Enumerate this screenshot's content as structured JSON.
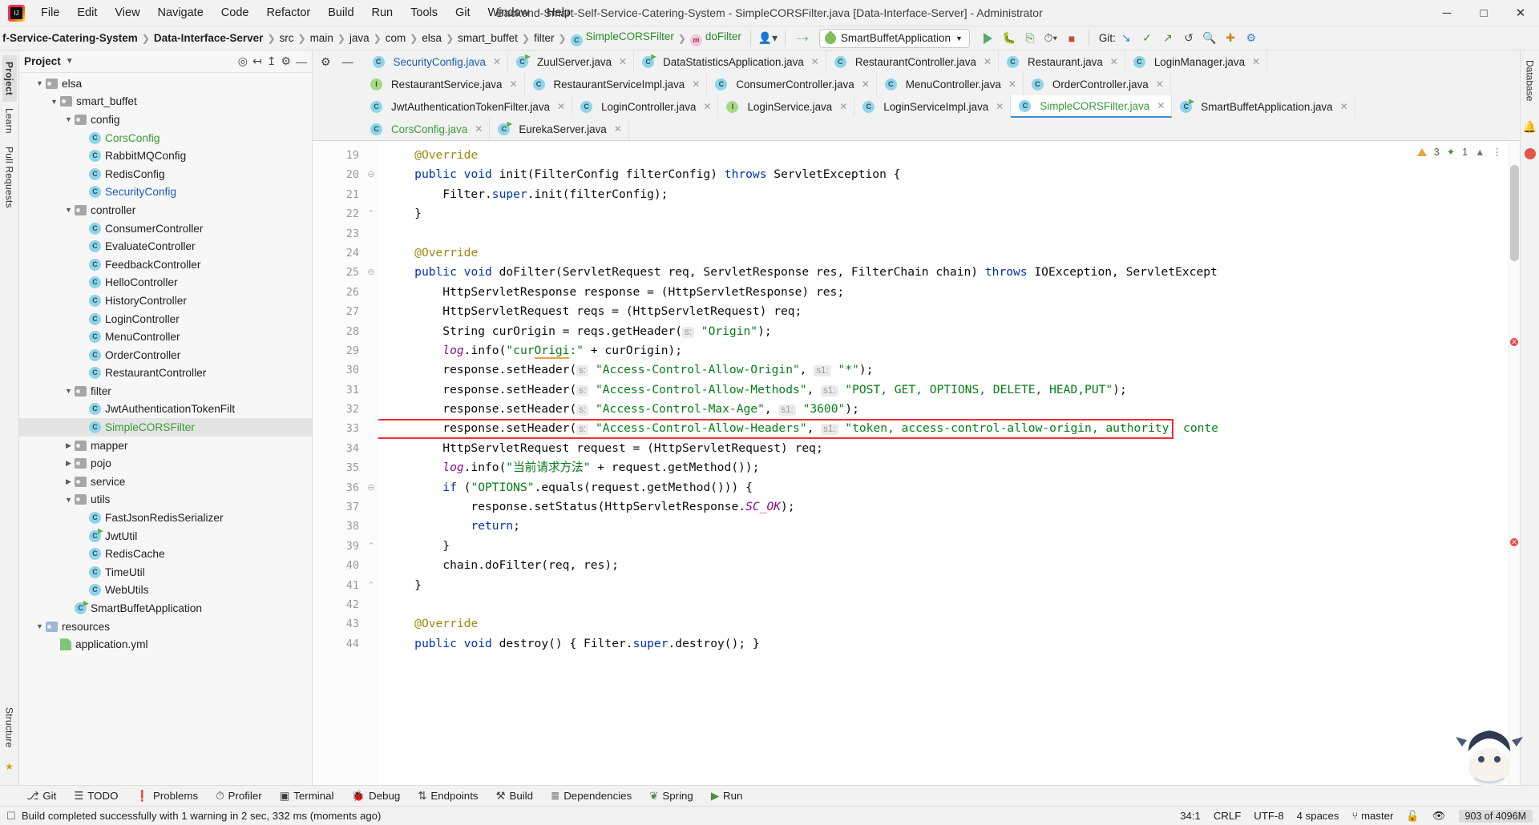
{
  "window": {
    "title": "Backend-Smart-Self-Service-Catering-System - SimpleCORSFilter.java [Data-Interface-Server] - Administrator",
    "minimize": "─",
    "maximize": "□",
    "close": "✕",
    "logo_text": "IJ"
  },
  "menu": [
    "File",
    "Edit",
    "View",
    "Navigate",
    "Code",
    "Refactor",
    "Build",
    "Run",
    "Tools",
    "Git",
    "Window",
    "Help"
  ],
  "breadcrumbs": [
    {
      "label": "f-Service-Catering-System",
      "style": "bold"
    },
    {
      "label": "Data-Interface-Server",
      "style": "bold"
    },
    {
      "label": "src",
      "style": "plain"
    },
    {
      "label": "main",
      "style": "plain"
    },
    {
      "label": "java",
      "style": "plain"
    },
    {
      "label": "com",
      "style": "plain"
    },
    {
      "label": "elsa",
      "style": "plain"
    },
    {
      "label": "smart_buffet",
      "style": "plain"
    },
    {
      "label": "filter",
      "style": "plain"
    },
    {
      "label": "SimpleCORSFilter",
      "style": "class-green"
    },
    {
      "label": "doFilter",
      "style": "method-green"
    }
  ],
  "toolbar": {
    "run_config": "SmartBuffetApplication",
    "git_label": "Git:",
    "icons": [
      "profile-icon",
      "hammer-icon",
      "run-icon",
      "debug-icon",
      "coverage-icon",
      "profiler-icon",
      "stop-icon",
      "git-update-icon",
      "git-commit-icon",
      "git-push-icon",
      "undo-icon",
      "search-icon",
      "plus-icon",
      "settings-icon"
    ]
  },
  "project_panel": {
    "title": "Project",
    "head_icons": [
      "target-icon",
      "collapse-icon",
      "expand-icon",
      "gear-icon",
      "hide-icon"
    ],
    "tree": [
      {
        "indent": 4,
        "kind": "folder",
        "label": "elsa",
        "arrow": "down",
        "color": "default"
      },
      {
        "indent": 5,
        "kind": "folder",
        "label": "smart_buffet",
        "arrow": "down",
        "color": "default"
      },
      {
        "indent": 6,
        "kind": "folder",
        "label": "config",
        "arrow": "down",
        "color": "default"
      },
      {
        "indent": 7,
        "kind": "class",
        "label": "CorsConfig",
        "arrow": "none",
        "color": "green"
      },
      {
        "indent": 7,
        "kind": "class",
        "label": "RabbitMQConfig",
        "arrow": "none",
        "color": "default"
      },
      {
        "indent": 7,
        "kind": "class",
        "label": "RedisConfig",
        "arrow": "none",
        "color": "default"
      },
      {
        "indent": 7,
        "kind": "class",
        "label": "SecurityConfig",
        "arrow": "none",
        "color": "blue"
      },
      {
        "indent": 6,
        "kind": "folder",
        "label": "controller",
        "arrow": "down",
        "color": "default"
      },
      {
        "indent": 7,
        "kind": "class",
        "label": "ConsumerController",
        "arrow": "none",
        "color": "default"
      },
      {
        "indent": 7,
        "kind": "class",
        "label": "EvaluateController",
        "arrow": "none",
        "color": "default"
      },
      {
        "indent": 7,
        "kind": "class",
        "label": "FeedbackController",
        "arrow": "none",
        "color": "default"
      },
      {
        "indent": 7,
        "kind": "class",
        "label": "HelloController",
        "arrow": "none",
        "color": "default"
      },
      {
        "indent": 7,
        "kind": "class",
        "label": "HistoryController",
        "arrow": "none",
        "color": "default"
      },
      {
        "indent": 7,
        "kind": "class",
        "label": "LoginController",
        "arrow": "none",
        "color": "default"
      },
      {
        "indent": 7,
        "kind": "class",
        "label": "MenuController",
        "arrow": "none",
        "color": "default"
      },
      {
        "indent": 7,
        "kind": "class",
        "label": "OrderController",
        "arrow": "none",
        "color": "default"
      },
      {
        "indent": 7,
        "kind": "class",
        "label": "RestaurantController",
        "arrow": "none",
        "color": "default"
      },
      {
        "indent": 6,
        "kind": "folder",
        "label": "filter",
        "arrow": "down",
        "color": "default"
      },
      {
        "indent": 7,
        "kind": "class",
        "label": "JwtAuthenticationTokenFilt",
        "arrow": "none",
        "color": "default"
      },
      {
        "indent": 7,
        "kind": "class",
        "label": "SimpleCORSFilter",
        "arrow": "none",
        "color": "green",
        "selected": true
      },
      {
        "indent": 6,
        "kind": "folder",
        "label": "mapper",
        "arrow": "right",
        "color": "default"
      },
      {
        "indent": 6,
        "kind": "folder",
        "label": "pojo",
        "arrow": "right",
        "color": "default"
      },
      {
        "indent": 6,
        "kind": "folder",
        "label": "service",
        "arrow": "right",
        "color": "default"
      },
      {
        "indent": 6,
        "kind": "folder",
        "label": "utils",
        "arrow": "down",
        "color": "default"
      },
      {
        "indent": 7,
        "kind": "class",
        "label": "FastJsonRedisSerializer",
        "arrow": "none",
        "color": "default"
      },
      {
        "indent": 7,
        "kind": "class-spring",
        "label": "JwtUtil",
        "arrow": "none",
        "color": "default"
      },
      {
        "indent": 7,
        "kind": "class",
        "label": "RedisCache",
        "arrow": "none",
        "color": "default"
      },
      {
        "indent": 7,
        "kind": "class",
        "label": "TimeUtil",
        "arrow": "none",
        "color": "default"
      },
      {
        "indent": 7,
        "kind": "class",
        "label": "WebUtils",
        "arrow": "none",
        "color": "default"
      },
      {
        "indent": 6,
        "kind": "class-spring",
        "label": "SmartBuffetApplication",
        "arrow": "none",
        "color": "default"
      },
      {
        "indent": 4,
        "kind": "folder-res",
        "label": "resources",
        "arrow": "down",
        "color": "default"
      },
      {
        "indent": 5,
        "kind": "xml",
        "label": "application.yml",
        "arrow": "none",
        "color": "default"
      }
    ]
  },
  "left_rail": [
    "Project",
    "Learn",
    "Pull Requests",
    "Structure",
    "Favorites"
  ],
  "right_rail": [
    "Database",
    "Notifications"
  ],
  "editor_tabs": [
    [
      {
        "label": "SecurityConfig.java",
        "icon": "class-icon",
        "color": "blue"
      },
      {
        "label": "ZuulServer.java",
        "icon": "spring-class-icon",
        "color": "default"
      },
      {
        "label": "DataStatisticsApplication.java",
        "icon": "spring-class-icon",
        "color": "default"
      },
      {
        "label": "RestaurantController.java",
        "icon": "class-icon",
        "color": "default"
      },
      {
        "label": "Restaurant.java",
        "icon": "class-icon",
        "color": "default"
      },
      {
        "label": "LoginManager.java",
        "icon": "class-icon",
        "color": "default"
      }
    ],
    [
      {
        "label": "RestaurantService.java",
        "icon": "interface-icon",
        "color": "default"
      },
      {
        "label": "RestaurantServiceImpl.java",
        "icon": "class-icon",
        "color": "default"
      },
      {
        "label": "ConsumerController.java",
        "icon": "class-icon",
        "color": "default"
      },
      {
        "label": "MenuController.java",
        "icon": "class-icon",
        "color": "default"
      },
      {
        "label": "OrderController.java",
        "icon": "class-icon",
        "color": "default"
      }
    ],
    [
      {
        "label": "JwtAuthenticationTokenFilter.java",
        "icon": "class-icon",
        "color": "default"
      },
      {
        "label": "LoginController.java",
        "icon": "class-icon",
        "color": "default"
      },
      {
        "label": "LoginService.java",
        "icon": "interface-icon",
        "color": "default"
      },
      {
        "label": "LoginServiceImpl.java",
        "icon": "class-icon",
        "color": "default"
      },
      {
        "label": "SimpleCORSFilter.java",
        "icon": "class-icon",
        "color": "green",
        "active": true
      },
      {
        "label": "SmartBuffetApplication.java",
        "icon": "spring-class-icon",
        "color": "default"
      }
    ],
    [
      {
        "label": "CorsConfig.java",
        "icon": "class-icon",
        "color": "green"
      },
      {
        "label": "EurekaServer.java",
        "icon": "spring-class-icon",
        "color": "default"
      }
    ]
  ],
  "inspection": {
    "warnings": "3",
    "weak_warnings": "1",
    "warn_icon": "warning-triangle-icon",
    "weak_icon": "weak-warning-icon"
  },
  "code": {
    "first_line_number": 19,
    "highlight_line_number": 33,
    "lines": [
      {
        "n": 19,
        "html": "    <span class='ann'>@Override</span>"
      },
      {
        "n": 20,
        "html": "    <span class='kw'>public</span> <span class='kw'>void</span> init(FilterConfig filterConfig) <span class='kw'>throws</span> ServletException {",
        "gutter_mark": "override-impl",
        "fold": "open"
      },
      {
        "n": 21,
        "html": "        Filter.<span class='kw'>super</span>.init(filterConfig);"
      },
      {
        "n": 22,
        "html": "    }",
        "fold": "close"
      },
      {
        "n": 23,
        "html": ""
      },
      {
        "n": 24,
        "html": "    <span class='ann'>@Override</span>"
      },
      {
        "n": 25,
        "html": "    <span class='kw'>public</span> <span class='kw'>void</span> doFilter(ServletRequest req, ServletResponse res, FilterChain chain) <span class='kw'>throws</span> IOException, ServletExcept",
        "gutter_mark": "override",
        "fold": "open"
      },
      {
        "n": 26,
        "html": "        HttpServletResponse response = (HttpServletResponse) res;"
      },
      {
        "n": 27,
        "html": "        HttpServletRequest reqs = (HttpServletRequest) req;"
      },
      {
        "n": 28,
        "html": "        String curOrigin = reqs.getHeader(<span class='hint'>s:</span> <span class='str'>\"Origin\"</span>);"
      },
      {
        "n": 29,
        "html": "        <span class='fld'>log</span>.info(<span class='str'>\"cur<span class='typo'>Origi</span>:\"</span> + curOrigin);"
      },
      {
        "n": 30,
        "html": "        response.setHeader(<span class='hint'>s:</span> <span class='str'>\"Access-Control-Allow-Origin\"</span>, <span class='hint'>s1:</span> <span class='str'>\"*\"</span>);"
      },
      {
        "n": 31,
        "html": "        response.setHeader(<span class='hint'>s:</span> <span class='str'>\"Access-Control-Allow-Methods\"</span>, <span class='hint'>s1:</span> <span class='str'>\"POST, GET, OPTIONS, DELETE, HEAD,PUT\"</span>);"
      },
      {
        "n": 32,
        "html": "        response.setHeader(<span class='hint'>s:</span> <span class='str'>\"Access-Control-Max-Age\"</span>, <span class='hint'>s1:</span> <span class='str'>\"3600\"</span>);"
      },
      {
        "n": 33,
        "html": "        response.setHeader(<span class='hint'>s:</span> <span class='str'>\"Access-Control-Allow-Headers\"</span>, <span class='hint'>s1:</span> <span class='str'>\"token, access-control-allow-origin, authority, conte</span>"
      },
      {
        "n": 34,
        "html": "        HttpServletRequest request = (HttpServletRequest) req;"
      },
      {
        "n": 35,
        "html": "        <span class='fld'>log</span>.info(<span class='str'>\"当前请求方法\"</span> + request.getMethod());"
      },
      {
        "n": 36,
        "html": "        <span class='kw'>if</span> (<span class='str'>\"OPTIONS\"</span>.equals(request.getMethod())) {",
        "fold": "open"
      },
      {
        "n": 37,
        "html": "            response.setStatus(HttpServletResponse.<span class='cst'>SC_OK</span>);"
      },
      {
        "n": 38,
        "html": "            <span class='kw'>return</span>;"
      },
      {
        "n": 39,
        "html": "        }",
        "fold": "close"
      },
      {
        "n": 40,
        "html": "        chain.doFilter(req, res);"
      },
      {
        "n": 41,
        "html": "    }",
        "fold": "close"
      },
      {
        "n": 42,
        "html": ""
      },
      {
        "n": 43,
        "html": "    <span class='ann'>@Override</span>"
      },
      {
        "n": 44,
        "html": "    <span class='kw'>public</span> <span class='kw'>void</span> destroy() { Filter.<span class='kw'>super</span>.destroy(); }",
        "gutter_mark": "override"
      }
    ]
  },
  "bottom_toolwindows": [
    {
      "label": "Git",
      "icon": "git-branch-icon"
    },
    {
      "label": "TODO",
      "icon": "list-icon"
    },
    {
      "label": "Problems",
      "icon": "exclamation-circle-icon"
    },
    {
      "label": "Profiler",
      "icon": "profiler-icon"
    },
    {
      "label": "Terminal",
      "icon": "terminal-icon"
    },
    {
      "label": "Debug",
      "icon": "bug-icon"
    },
    {
      "label": "Endpoints",
      "icon": "endpoints-icon"
    },
    {
      "label": "Build",
      "icon": "hammer-icon"
    },
    {
      "label": "Dependencies",
      "icon": "layers-icon"
    },
    {
      "label": "Spring",
      "icon": "spring-leaf-icon"
    },
    {
      "label": "Run",
      "icon": "run-icon"
    }
  ],
  "statusbar": {
    "message": "Build completed successfully with 1 warning in 2 sec, 332 ms (moments ago)",
    "message_icon": "build-status-icon",
    "caret": "34:1",
    "line_separator": "CRLF",
    "encoding": "UTF-8",
    "indent": "4 spaces",
    "branch": "master",
    "branch_icon": "git-branch-icon",
    "lock_icon": "lock-icon",
    "inspection_icon": "inspection-eye-icon",
    "memory": "903 of 4096M"
  },
  "colors": {
    "accent": "#3b8cdb",
    "string_green": "#067d17",
    "keyword_blue": "#0033b3",
    "error_red": "#ef2f2f",
    "vcs_green": "#3a9c3a",
    "vcs_blue": "#1a5fb4"
  }
}
